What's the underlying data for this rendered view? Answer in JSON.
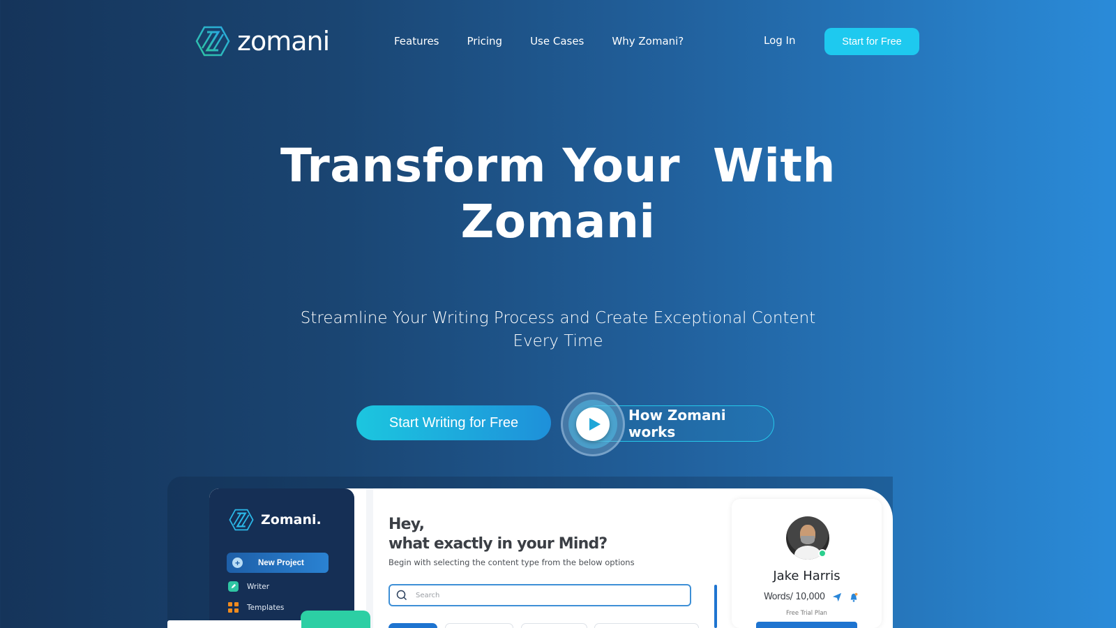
{
  "brand": {
    "name": "zomani",
    "accent": "#1ec9ef",
    "teal": "#2fc5a3"
  },
  "nav": {
    "links": [
      {
        "label": "Features"
      },
      {
        "label": "Pricing"
      },
      {
        "label": "Use Cases"
      },
      {
        "label": "Why Zomani?"
      }
    ],
    "login_label": "Log In",
    "cta_label": "Start for Free"
  },
  "hero": {
    "title_line1": "Transform Your  With",
    "title_line2": "Zomani",
    "subtitle": "Streamline Your Writing Process and Create Exceptional Content Every Time",
    "primary_cta": "Start Writing for Free",
    "secondary_cta": "How Zomani works",
    "play_icon": "play-icon"
  },
  "app_preview": {
    "sidebar": {
      "brand": "Zomani.",
      "new_project_label": "New Project",
      "items": [
        {
          "label": "Writer",
          "icon": "pen-icon"
        },
        {
          "label": "Templates",
          "icon": "grid-icon"
        }
      ]
    },
    "main": {
      "greeting_line1": "Hey,",
      "greeting_line2": "what exactly in your Mind?",
      "instruction": "Begin with selecting the content type from the below options",
      "search_placeholder": "Search"
    },
    "profile": {
      "name": "Jake Harris",
      "words": "Words/ 10,000",
      "plan": "Free Trial Plan",
      "status": "online"
    }
  }
}
